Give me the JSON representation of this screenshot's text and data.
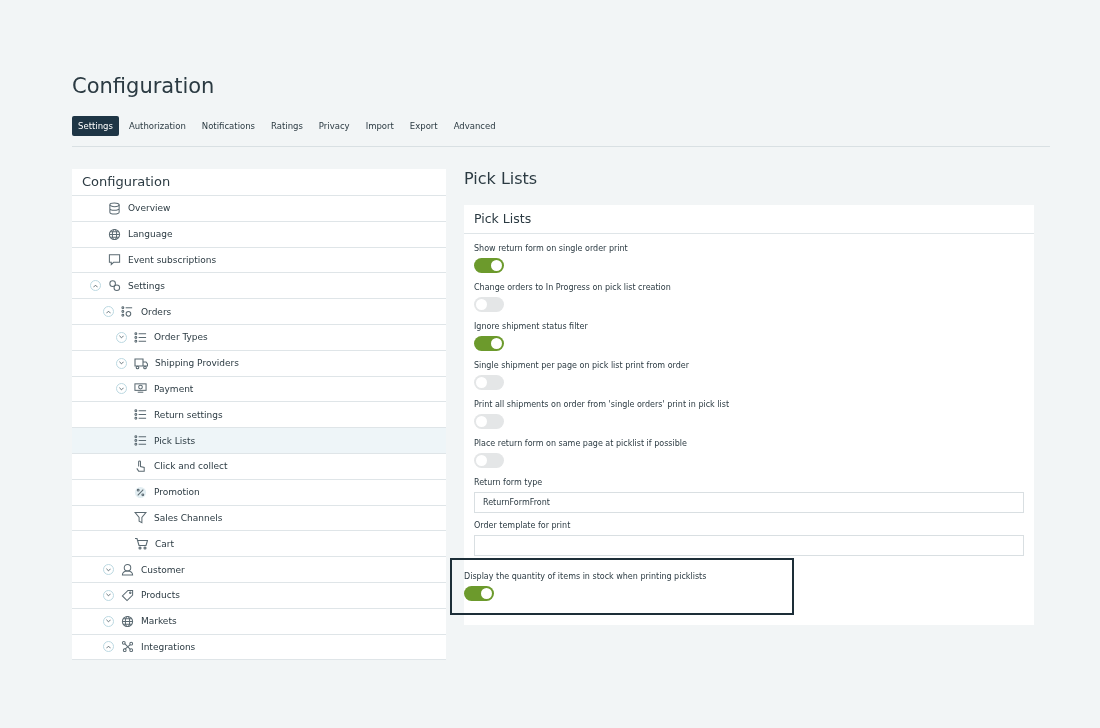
{
  "page": {
    "title": "Configuration"
  },
  "tabs": [
    {
      "label": "Settings",
      "selected": true
    },
    {
      "label": "Authorization",
      "selected": false
    },
    {
      "label": "Notifications",
      "selected": false
    },
    {
      "label": "Ratings",
      "selected": false
    },
    {
      "label": "Privacy",
      "selected": false
    },
    {
      "label": "Import",
      "selected": false
    },
    {
      "label": "Export",
      "selected": false
    },
    {
      "label": "Advanced",
      "selected": false
    }
  ],
  "sidebar": {
    "title": "Configuration",
    "items": [
      {
        "label": "Overview",
        "selected": false
      },
      {
        "label": "Language",
        "selected": false
      },
      {
        "label": "Event subscriptions",
        "selected": false
      },
      {
        "label": "Settings",
        "selected": false,
        "expanded": true,
        "children": [
          {
            "label": "Orders",
            "selected": false,
            "expanded": true,
            "children": [
              {
                "label": "Order Types",
                "selected": false,
                "expanded": false
              },
              {
                "label": "Shipping Providers",
                "selected": false,
                "expanded": false
              },
              {
                "label": "Payment",
                "selected": false,
                "expanded": false
              },
              {
                "label": "Return settings",
                "selected": false
              },
              {
                "label": "Pick Lists",
                "selected": true
              },
              {
                "label": "Click and collect",
                "selected": false
              },
              {
                "label": "Promotion",
                "selected": false
              },
              {
                "label": "Sales Channels",
                "selected": false
              },
              {
                "label": "Cart",
                "selected": false
              }
            ]
          },
          {
            "label": "Customer",
            "selected": false,
            "expanded": false
          },
          {
            "label": "Products",
            "selected": false,
            "expanded": false
          },
          {
            "label": "Markets",
            "selected": false,
            "expanded": false
          },
          {
            "label": "Integrations",
            "selected": false,
            "expanded": true
          }
        ]
      }
    ]
  },
  "content": {
    "title": "Pick Lists",
    "card": {
      "title": "Pick Lists",
      "fields": [
        {
          "kind": "toggle",
          "label": "Show return form on single order print",
          "on": true,
          "highlighted": false
        },
        {
          "kind": "toggle",
          "label": "Change orders to In Progress on pick list creation",
          "on": false,
          "highlighted": false
        },
        {
          "kind": "toggle",
          "label": "Ignore shipment status filter",
          "on": true,
          "highlighted": false
        },
        {
          "kind": "toggle",
          "label": "Single shipment per page on pick list print from order",
          "on": false,
          "highlighted": false
        },
        {
          "kind": "toggle",
          "label": "Print all shipments on order from 'single orders' print in pick list",
          "on": false,
          "highlighted": false
        },
        {
          "kind": "toggle",
          "label": "Place return form on same page at picklist if possible",
          "on": false,
          "highlighted": false
        },
        {
          "kind": "text",
          "label": "Return form type",
          "value": "ReturnFormFront",
          "highlighted": false
        },
        {
          "kind": "text",
          "label": "Order template for print",
          "highlighted": false
        },
        {
          "kind": "toggle",
          "label": "Display the quantity of items in stock when printing picklists",
          "on": true,
          "highlighted": true
        }
      ]
    }
  }
}
